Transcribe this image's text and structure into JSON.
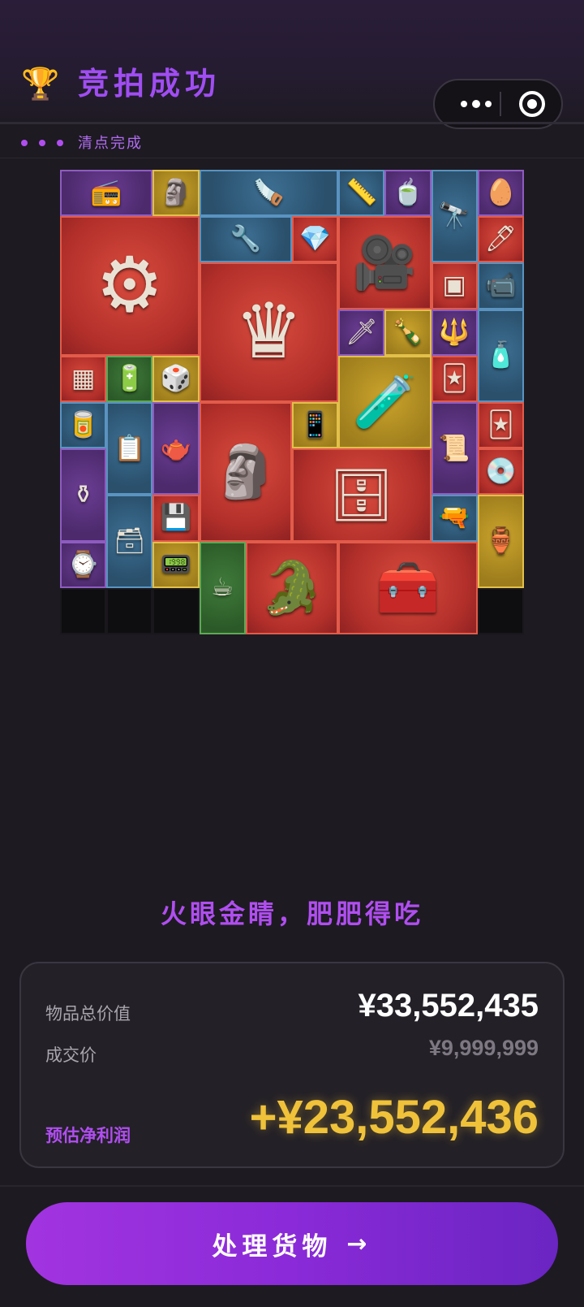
{
  "header": {
    "title": "竞拍成功",
    "icon": "trophy-icon"
  },
  "status": {
    "text": "清点完成"
  },
  "capsule": {
    "more_icon": "more-dots-icon",
    "close_icon": "target-icon"
  },
  "grid": {
    "items": [
      {
        "name": "boombox",
        "color": "purple",
        "glyph": "📻"
      },
      {
        "name": "figurine",
        "color": "gold",
        "glyph": "🗿"
      },
      {
        "name": "saw",
        "color": "blue",
        "glyph": "🪚"
      },
      {
        "name": "caliper",
        "color": "blue",
        "glyph": "📏"
      },
      {
        "name": "tea-dish",
        "color": "purple",
        "glyph": "🍵"
      },
      {
        "name": "telescope",
        "color": "blue",
        "glyph": "🔭"
      },
      {
        "name": "egg",
        "color": "purple",
        "glyph": "🥚"
      },
      {
        "name": "generator",
        "color": "red",
        "glyph": "⚙"
      },
      {
        "name": "drill",
        "color": "blue",
        "glyph": "🔧"
      },
      {
        "name": "diamond",
        "color": "red",
        "glyph": "💎"
      },
      {
        "name": "video-camera",
        "color": "red",
        "glyph": "🎥"
      },
      {
        "name": "pen",
        "color": "red",
        "glyph": "🖊"
      },
      {
        "name": "chess-board",
        "color": "red",
        "glyph": "♛"
      },
      {
        "name": "circuit-module",
        "color": "red",
        "glyph": "▣"
      },
      {
        "name": "cctv-camera",
        "color": "blue",
        "glyph": "📹"
      },
      {
        "name": "dagger",
        "color": "purple",
        "glyph": "🗡"
      },
      {
        "name": "liquor-bottle",
        "color": "gold",
        "glyph": "🍾"
      },
      {
        "name": "spearhead",
        "color": "purple",
        "glyph": "🔱"
      },
      {
        "name": "ink-bottle",
        "color": "blue",
        "glyph": "🧴"
      },
      {
        "name": "gadget",
        "color": "red",
        "glyph": "▦"
      },
      {
        "name": "battery",
        "color": "green",
        "glyph": "🔋"
      },
      {
        "name": "cube-block",
        "color": "gold",
        "glyph": "🎲"
      },
      {
        "name": "chemical-jug",
        "color": "gold",
        "glyph": "🧪"
      },
      {
        "name": "playing-card",
        "color": "red",
        "glyph": "🃏"
      },
      {
        "name": "tin-box",
        "color": "blue",
        "glyph": "🥫"
      },
      {
        "name": "confidential-file",
        "color": "blue",
        "glyph": "📋"
      },
      {
        "name": "teapot",
        "color": "purple",
        "glyph": "🫖"
      },
      {
        "name": "caesar-bust",
        "color": "red",
        "glyph": "🗿"
      },
      {
        "name": "smartphone",
        "color": "gold",
        "glyph": "📱"
      },
      {
        "name": "old-document",
        "color": "purple",
        "glyph": "📜"
      },
      {
        "name": "card-2",
        "color": "red",
        "glyph": "🃏"
      },
      {
        "name": "hookah",
        "color": "purple",
        "glyph": "⚱"
      },
      {
        "name": "disc",
        "color": "red",
        "glyph": "💿"
      },
      {
        "name": "server-rack",
        "color": "red",
        "glyph": "🗄"
      },
      {
        "name": "ammo-box",
        "color": "blue",
        "glyph": "🗃"
      },
      {
        "name": "usb-stick",
        "color": "red",
        "glyph": "💾"
      },
      {
        "name": "thermometer-gun",
        "color": "blue",
        "glyph": "🔫"
      },
      {
        "name": "perfume-bottle",
        "color": "gold",
        "glyph": "🏺"
      },
      {
        "name": "smartwatch",
        "color": "purple",
        "glyph": "⌚"
      },
      {
        "name": "plc-unit",
        "color": "gold",
        "glyph": "📟"
      },
      {
        "name": "coffee-bag",
        "color": "green",
        "glyph": "☕"
      },
      {
        "name": "crocodile-statue",
        "color": "red",
        "glyph": "🐊"
      },
      {
        "name": "military-case",
        "color": "red",
        "glyph": "🧰"
      },
      {
        "name": "empty-1",
        "color": "dark",
        "glyph": ""
      },
      {
        "name": "empty-2",
        "color": "dark",
        "glyph": ""
      },
      {
        "name": "empty-3",
        "color": "dark",
        "glyph": ""
      },
      {
        "name": "empty-4",
        "color": "dark",
        "glyph": ""
      }
    ]
  },
  "slogan": "火眼金睛，肥肥得吃",
  "summary": {
    "total_label": "物品总价值",
    "total_value": "¥33,552,435",
    "deal_label": "成交价",
    "deal_value": "¥9,999,999",
    "profit_label": "预估净利润",
    "profit_value": "+¥23,552,436"
  },
  "action": {
    "label": "处理货物",
    "arrow": "→"
  },
  "colors": {
    "accent": "#b04ef0",
    "gold": "#f0c23a",
    "bg": "#1d1a21"
  }
}
